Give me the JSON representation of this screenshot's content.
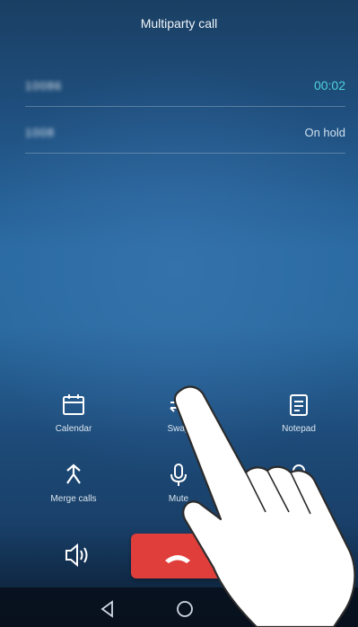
{
  "header": {
    "title": "Multiparty call"
  },
  "calls": [
    {
      "number": "10086",
      "status": "00:02"
    },
    {
      "number": "1008",
      "status": "On hold"
    }
  ],
  "actions": {
    "calendar": "Calendar",
    "swap": "Swap",
    "notepad": "Notepad",
    "merge": "Merge calls",
    "mute": "Mute",
    "contacts": "Contacts"
  },
  "colors": {
    "end_call": "#e03e3a",
    "timer": "#4fd1d9"
  }
}
